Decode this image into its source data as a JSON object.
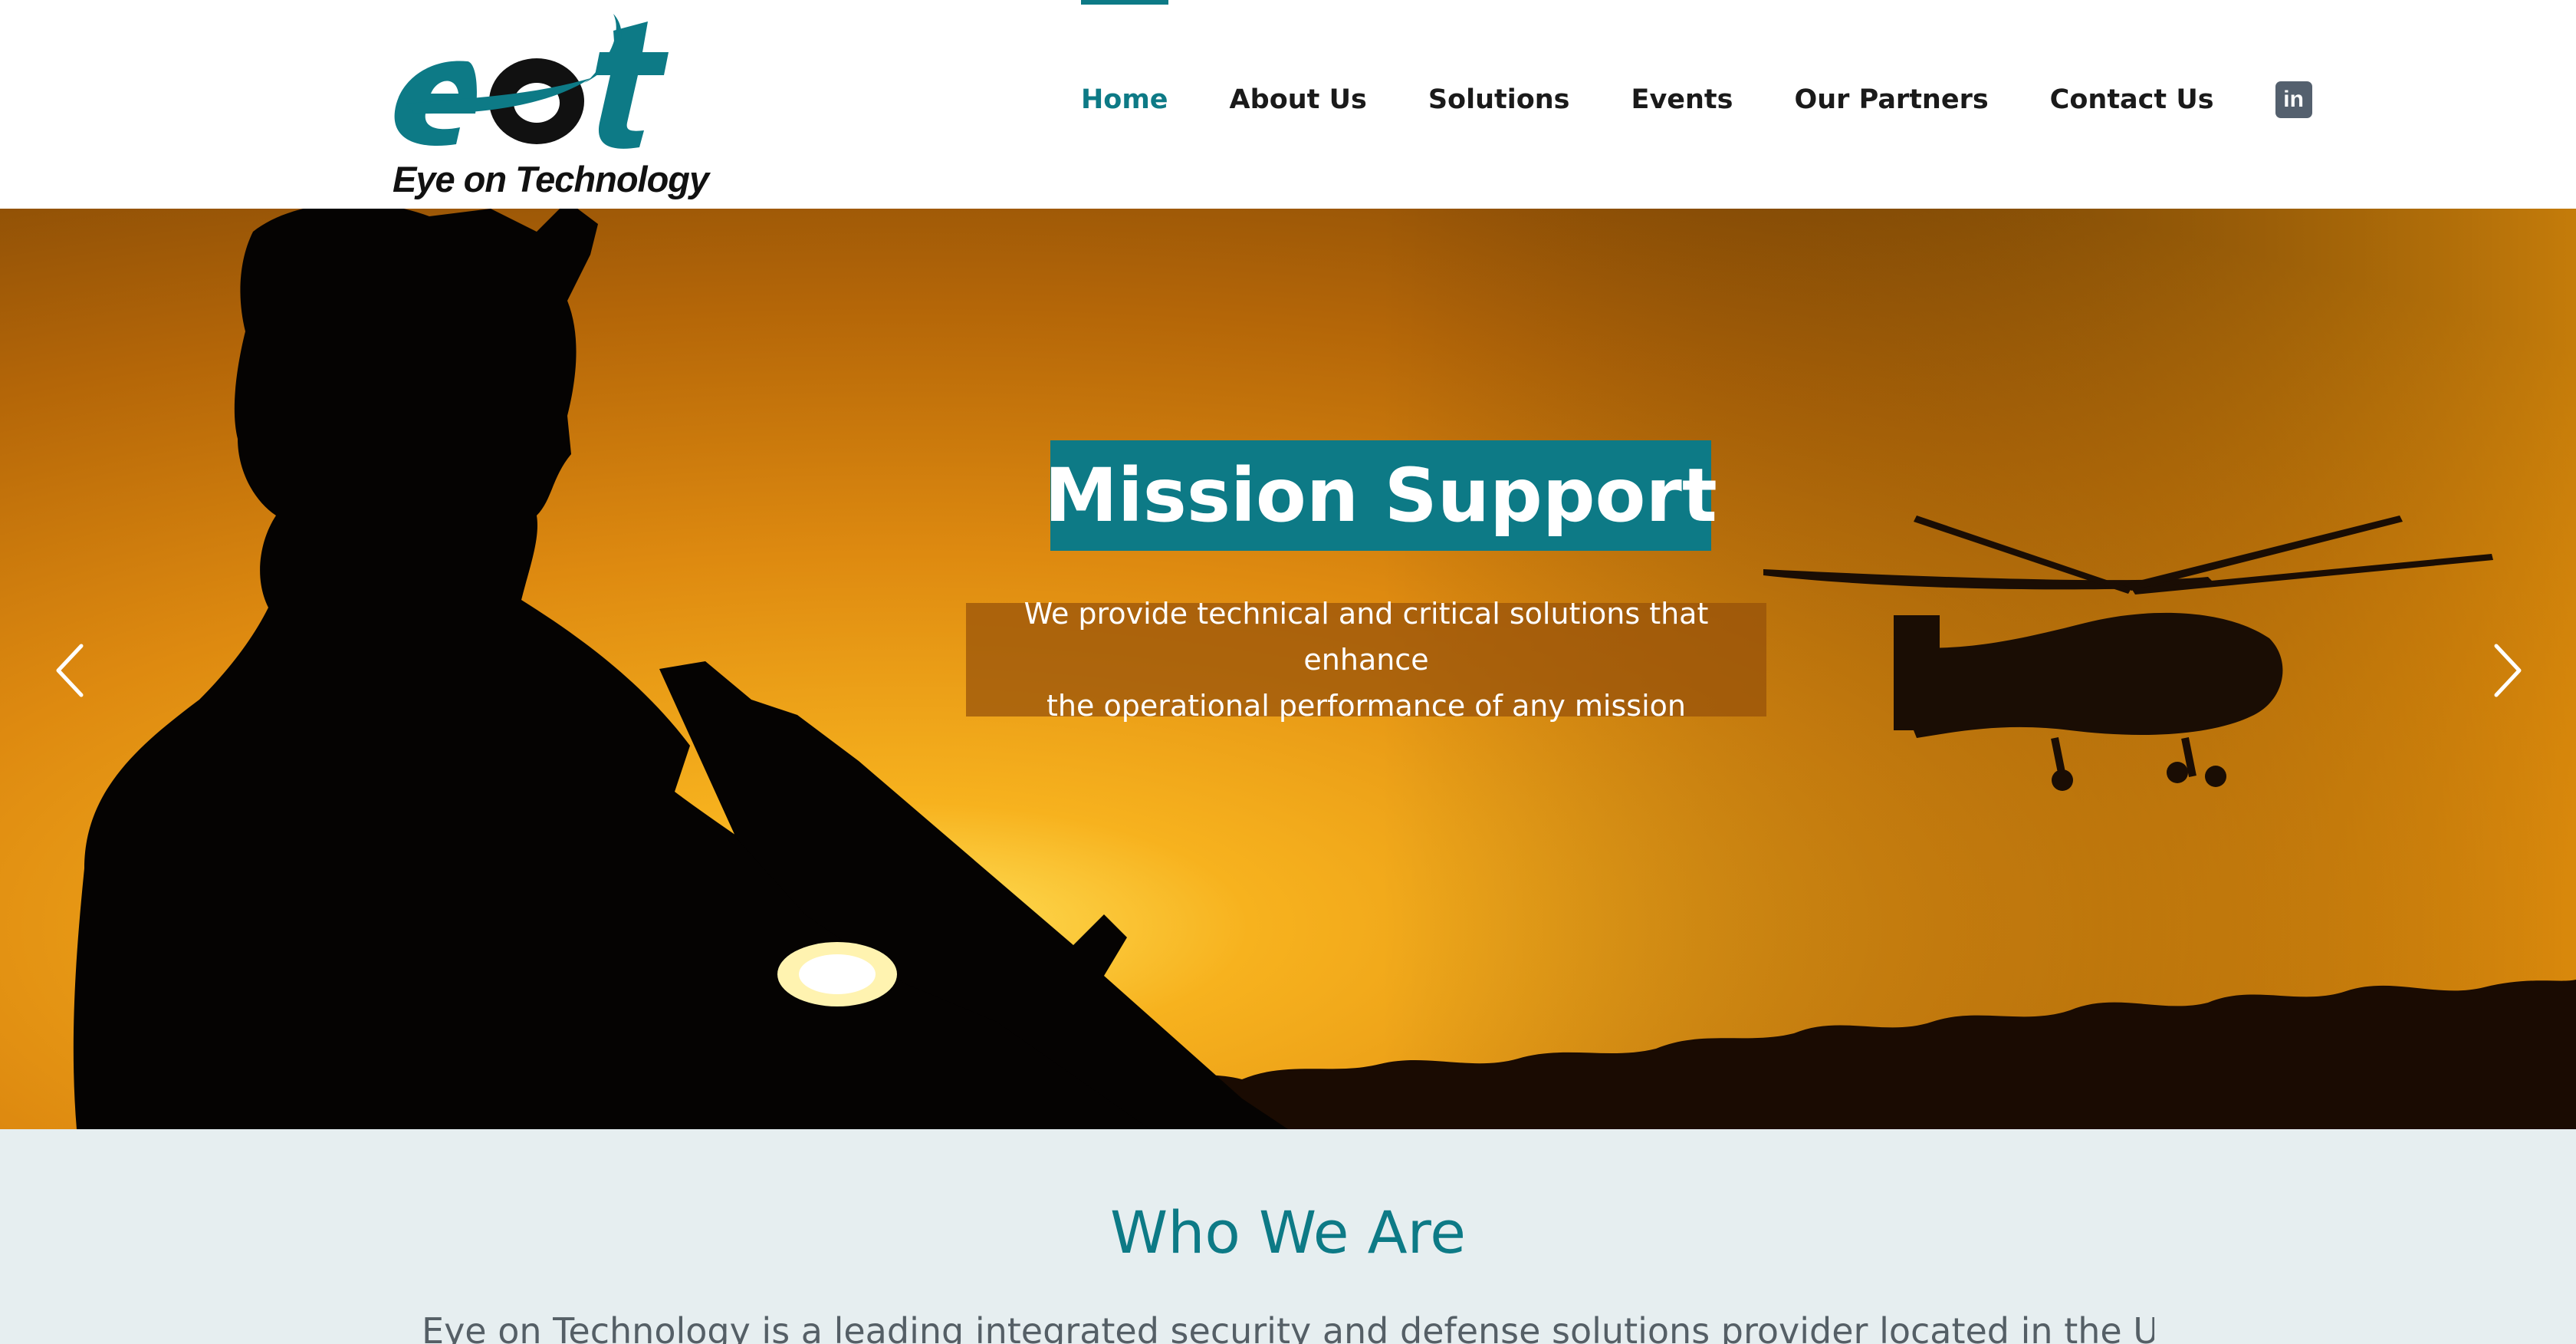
{
  "brand": {
    "logo_text": "eot",
    "tagline": "Eye on Technology",
    "color": "#0d7a86"
  },
  "nav": {
    "items": [
      {
        "label": "Home",
        "active": true
      },
      {
        "label": "About Us",
        "active": false
      },
      {
        "label": "Solutions",
        "active": false
      },
      {
        "label": "Events",
        "active": false
      },
      {
        "label": "Our Partners",
        "active": false
      },
      {
        "label": "Contact Us",
        "active": false
      }
    ],
    "social_icon": "linkedin-icon",
    "social_glyph": "in"
  },
  "hero": {
    "title": "Mission Support",
    "subtitle_line1": "We provide technical and critical solutions that enhance",
    "subtitle_line2": "the operational performance of any mission",
    "prev_icon": "chevron-left-icon",
    "next_icon": "chevron-right-icon"
  },
  "about": {
    "title": "Who We Are",
    "text": "Eye on Technology is a leading integrated security and defense solutions provider located in the United Arab"
  }
}
